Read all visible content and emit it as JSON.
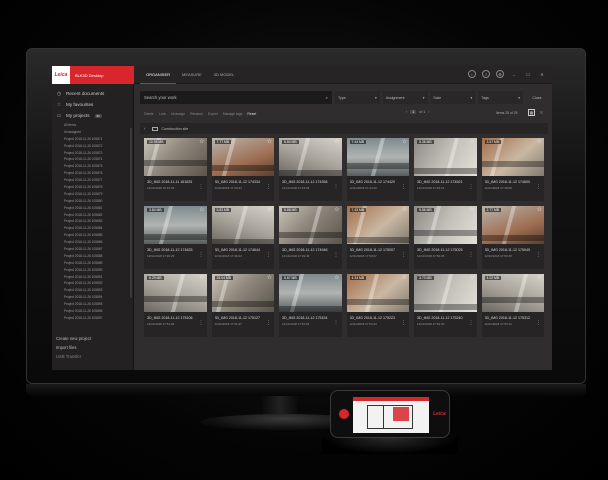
{
  "app": {
    "logo_text": "Leica",
    "title": "BLK3D Desktop",
    "nav_tabs": [
      "ORGANISER",
      "MEASURE",
      "3D MODEL"
    ]
  },
  "window_icons": [
    "i",
    "?",
    "⚙",
    "–",
    "☐",
    "✕"
  ],
  "sidebar": {
    "nav": [
      {
        "label": "Recent documents",
        "icon": "clock-icon"
      },
      {
        "label": "My favourites",
        "icon": "star-icon"
      },
      {
        "label": "My projects",
        "icon": "folder-icon",
        "badge": "86"
      }
    ],
    "projects": [
      "All items",
      "Unassigned",
      "Project 2018-11-26 105871",
      "Project 2018-11-26 105872",
      "Project 2018-11-26 105873",
      "Project 2018-11-26 105874",
      "Project 2018-11-26 105875",
      "Project 2018-11-26 105876",
      "Project 2018-11-26 105877",
      "Project 2018-11-26 105878",
      "Project 2018-11-26 105879",
      "Project 2018-11-26 105880",
      "Project 2018-11-26 105881",
      "Project 2018-11-26 105882",
      "Project 2018-11-26 105883",
      "Project 2018-11-26 105884",
      "Project 2018-11-26 105885",
      "Project 2018-11-26 105886",
      "Project 2018-11-26 105887",
      "Project 2018-11-26 105888",
      "Project 2018-11-26 105889",
      "Project 2018-11-26 105890",
      "Project 2018-11-26 105891",
      "Project 2018-11-26 105892",
      "Project 2018-11-26 105893",
      "Project 2018-11-26 105894",
      "Project 2018-11-26 105895",
      "Project 2018-11-26 105896",
      "Project 2018-11-26 105897"
    ],
    "bottom": [
      "Create new project",
      "Import files",
      "USB Transfer"
    ]
  },
  "search": {
    "placeholder": "Search your work",
    "icon": "search-icon"
  },
  "filters": [
    {
      "label": "Type"
    },
    {
      "label": "Assignment"
    },
    {
      "label": "Date"
    },
    {
      "label": "Tags"
    }
  ],
  "close_label": "Close",
  "toolbar": [
    "Delete",
    "Lock",
    "Unassign",
    "Rename",
    "Export",
    "Manage tags",
    "Reset"
  ],
  "pager": {
    "page": "1",
    "of": "of 1",
    "items": "Items 25 of 25"
  },
  "path": {
    "folder": "Construction site"
  },
  "cards": [
    {
      "size": "10.95 MB",
      "name": "3D_IMG 2018-11-11 161625",
      "date": "12/11/2018 16:16:25",
      "tone": "tone-a"
    },
    {
      "size": "7.77 MB",
      "name": "3D_IMG 2018-11-12 174334",
      "date": "12/11/2018 17:43:34",
      "tone": "tone-b"
    },
    {
      "size": "5.84 MB",
      "name": "3D_IMG 2018-11-12 174356",
      "date": "12/11/2018 17:43:56",
      "tone": "tone-c"
    },
    {
      "size": "7.44 MB",
      "name": "3D_IMG 2018-11-12 174420",
      "date": "12/11/2018 17:44:20",
      "tone": "tone-f"
    },
    {
      "size": "5.36 MB",
      "name": "3D_IMG 2018-11-12 174521",
      "date": "12/11/2018 17:45:21",
      "tone": "tone-d"
    },
    {
      "size": "3.57 MB",
      "name": "3D_IMG 2018-11-12 174600",
      "date": "12/11/2018 17:46:00",
      "tone": "tone-e"
    },
    {
      "size": "3.84 MB",
      "name": "3D_IMG 2018-11-12 174625",
      "date": "12/11/2018 17:46:25",
      "tone": "tone-f"
    },
    {
      "size": "5.83 MB",
      "name": "3D_IMG 2018-11-12 174644",
      "date": "12/11/2018 17:46:44",
      "tone": "tone-c"
    },
    {
      "size": "5.88 MB",
      "name": "3D_IMG 2018-11-12 174946",
      "date": "12/11/2018 17:49:46",
      "tone": "tone-a"
    },
    {
      "size": "7.43 MB",
      "name": "3D_IMG 2018-11-12 175007",
      "date": "12/11/2018 17:50:07",
      "tone": "tone-e"
    },
    {
      "size": "5.56 MB",
      "name": "3D_IMG 2018-11-12 175025",
      "date": "12/11/2018 17:50:25",
      "tone": "tone-d"
    },
    {
      "size": "2.77 MB",
      "name": "3D_IMG 2018-11-12 175045",
      "date": "12/11/2018 17:50:45",
      "tone": "tone-b"
    },
    {
      "size": "6.29 MB",
      "name": "3D_IMG 2018-11-12 175106",
      "date": "12/11/2018 17:51:06",
      "tone": "tone-c"
    },
    {
      "size": "25.04 MB",
      "name": "3D_IMG 2018-11-12 175127",
      "date": "12/11/2018 17:51:27",
      "tone": "tone-a"
    },
    {
      "size": "5.67 MB",
      "name": "3D_IMG 2018-11-12 175154",
      "date": "12/11/2018 17:51:54",
      "tone": "tone-f"
    },
    {
      "size": "4.34 MB",
      "name": "3D_IMG 2018-11-12 175223",
      "date": "12/11/2018 17:52:23",
      "tone": "tone-e"
    },
    {
      "size": "3.70 MB",
      "name": "3D_IMG 2018-11-12 175240",
      "date": "12/11/2018 17:52:40",
      "tone": "tone-d"
    },
    {
      "size": "4.02 MB",
      "name": "3D_IMG 2018-11-12 175312",
      "date": "12/11/2018 17:53:12",
      "tone": "tone-c"
    }
  ],
  "phone": {
    "brand": "Leica"
  },
  "colors": {
    "accent": "#d8262c",
    "bg": "#2e2c2c"
  }
}
